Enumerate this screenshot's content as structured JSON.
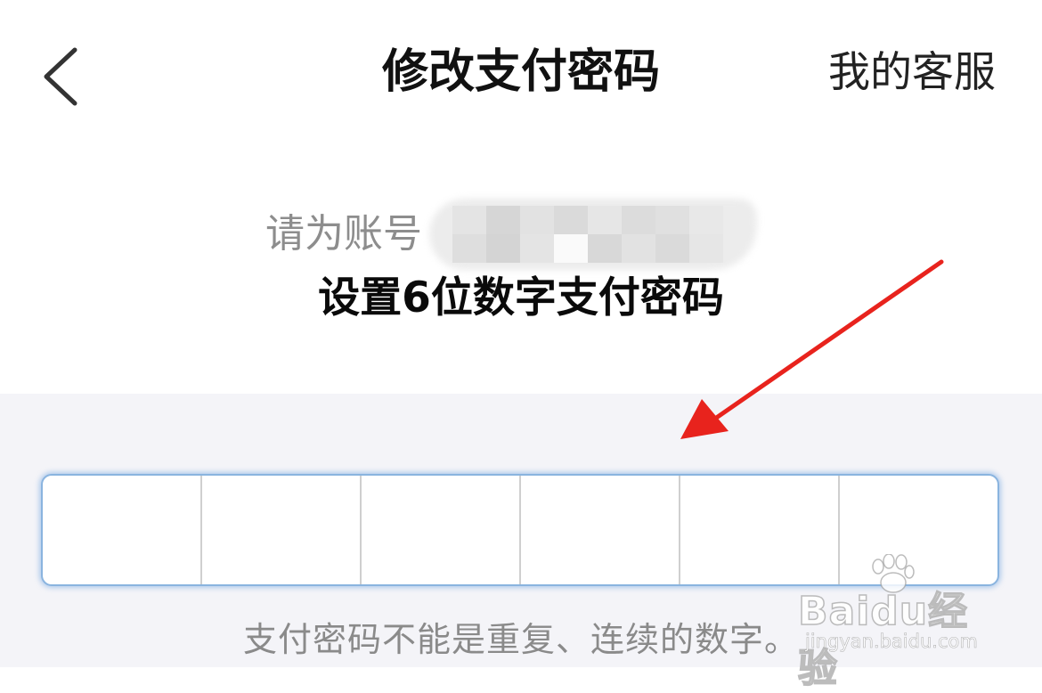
{
  "header": {
    "title": "修改支付密码",
    "service_label": "我的客服"
  },
  "prompt": {
    "account_prefix": "请为账号",
    "instruction": "设置6位数字支付密码"
  },
  "password": {
    "length": 6,
    "filled": 0
  },
  "hint": "支付密码不能是重复、连续的数字。",
  "watermark": {
    "logo": "Baidu经验",
    "url": "jingyan.baidu.com"
  },
  "colors": {
    "accent_border": "#8ab4df",
    "arrow": "#e8231d",
    "lower_background": "#f4f4f8"
  }
}
